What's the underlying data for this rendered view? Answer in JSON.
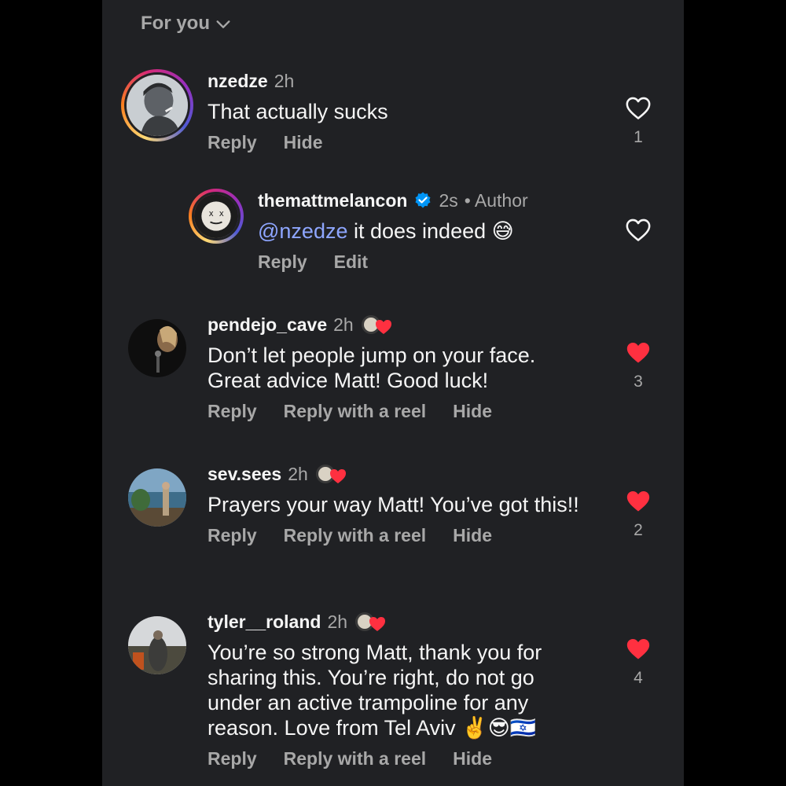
{
  "sort": {
    "label": "For you"
  },
  "colors": {
    "bg": "#202124",
    "muted": "#a8a8a8",
    "like": "#ff3040",
    "mention": "#8ea6ff",
    "verified": "#0095f6"
  },
  "comments": [
    {
      "username": "nzedze",
      "time": "2h",
      "text": "That actually sucks",
      "actions": [
        "Reply",
        "Hide"
      ],
      "likes": "1",
      "liked": false
    },
    {
      "username": "themattmelancon",
      "time": "2s",
      "role": "• Author",
      "mention": "@nzedze",
      "text": " it does indeed 😅",
      "actions": [
        "Reply",
        "Edit"
      ],
      "likes": "",
      "liked": false
    },
    {
      "username": "pendejo_cave",
      "time": "2h",
      "text": "Don’t let people jump on your face. Great advice Matt! Good luck!",
      "actions": [
        "Reply",
        "Reply with a reel",
        "Hide"
      ],
      "likes": "3",
      "liked": true
    },
    {
      "username": "sev.sees",
      "time": "2h",
      "text": "Prayers your way Matt! You’ve got this!!",
      "actions": [
        "Reply",
        "Reply with a reel",
        "Hide"
      ],
      "likes": "2",
      "liked": true
    },
    {
      "username": "tyler__roland",
      "time": "2h",
      "text": "You’re so strong Matt, thank you for sharing this. You’re right, do not go under an active trampoline for any reason. Love from Tel Aviv ✌️😎🇮🇱",
      "actions": [
        "Reply",
        "Reply with a reel",
        "Hide"
      ],
      "likes": "4",
      "liked": true
    }
  ]
}
